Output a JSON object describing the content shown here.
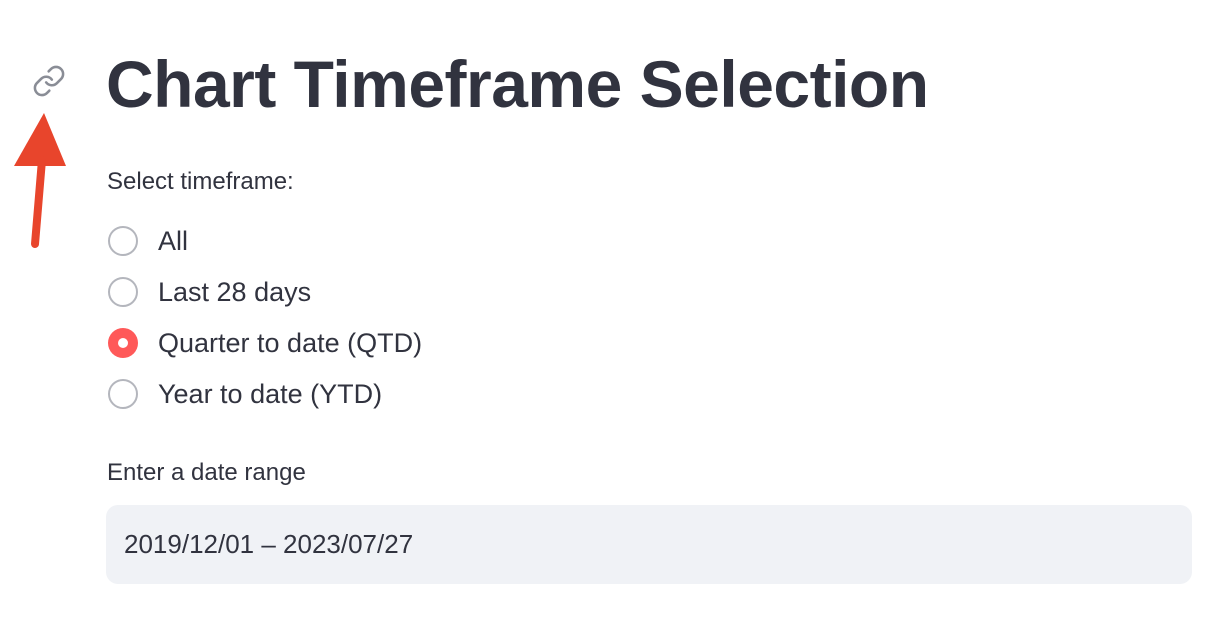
{
  "header": {
    "title": "Chart Timeframe Selection",
    "anchor_icon": "link-icon",
    "annotation_icon": "red-arrow-icon"
  },
  "timeframe": {
    "label": "Select timeframe:",
    "options": [
      {
        "label": "All",
        "selected": false
      },
      {
        "label": "Last 28 days",
        "selected": false
      },
      {
        "label": "Quarter to date (QTD)",
        "selected": true
      },
      {
        "label": "Year to date (YTD)",
        "selected": false
      }
    ]
  },
  "date_range": {
    "label": "Enter a date range",
    "value": "2019/12/01 – 2023/07/27"
  },
  "colors": {
    "accent": "#ff4b4b",
    "text": "#31333f",
    "input_bg": "#f0f2f6",
    "annotation": "#e8452c"
  }
}
